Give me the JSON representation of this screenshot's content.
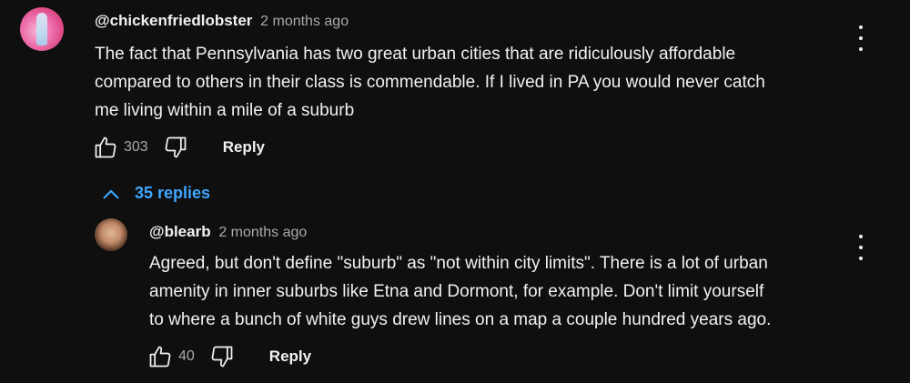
{
  "comment": {
    "author": "@chickenfriedlobster",
    "time": "2 months ago",
    "text_lines": [
      "The fact that Pennsylvania has two great urban cities that are ridiculously affordable",
      "compared to others in their class is commendable. If I lived in PA you would never catch",
      "me living within a mile of a suburb"
    ],
    "likes": "303",
    "reply_label": "Reply",
    "menu_icon": "more-vert-icon"
  },
  "replies_toggle": {
    "label": "35 replies",
    "icon": "chevron-up-icon"
  },
  "reply": {
    "author": "@blearb",
    "time": "2 months ago",
    "text_lines": [
      "Agreed, but don't define \"suburb\" as \"not within city limits\". There is a lot of urban",
      "amenity in inner suburbs like Etna and Dormont, for example. Don't limit yourself",
      "to where a bunch of white guys drew lines on a map a couple hundred years ago."
    ],
    "likes": "40",
    "reply_label": "Reply",
    "menu_icon": "more-vert-icon"
  },
  "colors": {
    "background": "#0f0f0f",
    "text": "#f1f1f1",
    "secondary": "#aaaaaa",
    "link": "#3ea6ff"
  }
}
